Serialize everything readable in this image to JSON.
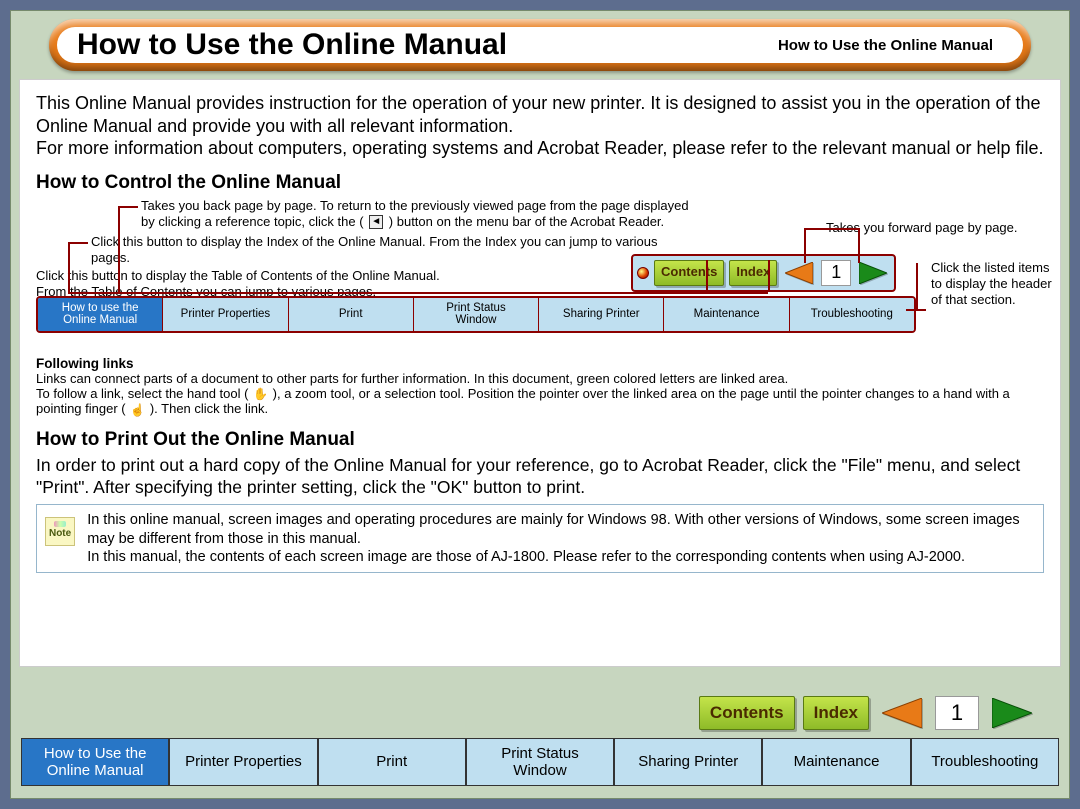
{
  "header": {
    "title": "How to Use the Online Manual",
    "subtitle": "How to Use the Online Manual"
  },
  "intro": {
    "p1": "This Online Manual provides instruction for the operation of your new printer. It is designed to assist you in the operation of the Online Manual and provide you with all relevant information.",
    "p2": "For more information about computers, operating systems and Acrobat Reader, please refer to the relevant manual or help file."
  },
  "section_control": {
    "heading": "How to Control the Online Manual",
    "callouts": {
      "back_line1": "Takes you back page by page. To return to the previously viewed page from the page displayed",
      "back_line2_pre": "by clicking a reference topic, click the (",
      "back_line2_post": ") button on the menu bar of the Acrobat Reader.",
      "index_text": "Click this button to display the Index of the Online Manual. From the Index you can jump to various pages.",
      "contents_line1": "Click this button to display the Table of Contents of the Online Manual.",
      "contents_line2": "From the Table of Contents you can jump to various pages.",
      "forward_text": "Takes you forward page by page.",
      "tabs_text": "Click the listed items to display the header of that section."
    },
    "buttons": {
      "contents_label": "Contents",
      "index_label": "Index",
      "page_number": "1"
    },
    "tabs": [
      {
        "line1": "How to use the",
        "line2": "Online Manual",
        "active": true
      },
      {
        "line1": "Printer Properties",
        "line2": "",
        "active": false
      },
      {
        "line1": "Print",
        "line2": "",
        "active": false
      },
      {
        "line1": "Print Status",
        "line2": "Window",
        "active": false
      },
      {
        "line1": "Sharing Printer",
        "line2": "",
        "active": false
      },
      {
        "line1": "Maintenance",
        "line2": "",
        "active": false
      },
      {
        "line1": "Troubleshooting",
        "line2": "",
        "active": false
      }
    ]
  },
  "following_links": {
    "heading": "Following links",
    "line1": "Links can connect parts of a document to other parts for further information. In this document, green colored letters are linked area.",
    "line2_pre": "To follow a link, select the hand tool (",
    "line2_mid": "), a zoom tool, or a selection tool. Position the pointer over the linked area on the page until the pointer changes to a hand with a pointing finger (",
    "line2_post": "). Then click the link."
  },
  "section_print": {
    "heading": "How to Print Out the Online Manual",
    "p1": "In order to print out a hard copy of the Online Manual for your reference, go to Acrobat Reader, click the \"File\" menu, and select \"Print\". After specifying the printer setting, click the \"OK\" button to print."
  },
  "note": {
    "label": "Note",
    "line1": "In this online manual, screen images and operating procedures are mainly for Windows 98. With other versions of Windows, some screen images may be different from those in this manual.",
    "line2": "In this manual, the contents of each screen image are those of AJ-1800. Please refer to the corresponding contents when using AJ-2000."
  },
  "bottom": {
    "contents_label": "Contents",
    "index_label": "Index",
    "page_number": "1",
    "tabs": [
      {
        "line1": "How to Use the",
        "line2": "Online Manual",
        "active": true
      },
      {
        "line1": "Printer Properties",
        "line2": "",
        "active": false
      },
      {
        "line1": "Print",
        "line2": "",
        "active": false
      },
      {
        "line1": "Print Status",
        "line2": "Window",
        "active": false
      },
      {
        "line1": "Sharing Printer",
        "line2": "",
        "active": false
      },
      {
        "line1": "Maintenance",
        "line2": "",
        "active": false
      },
      {
        "line1": "Troubleshooting",
        "line2": "",
        "active": false
      }
    ]
  }
}
